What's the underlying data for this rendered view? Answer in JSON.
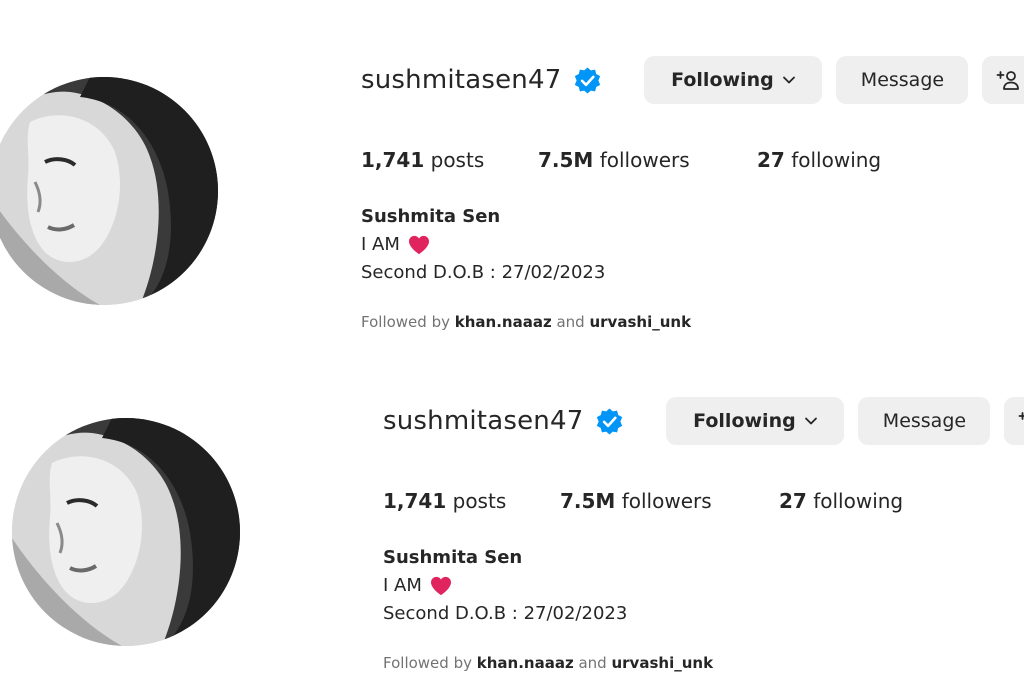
{
  "profiles": [
    {
      "username": "sushmitasen47",
      "following_label": "Following",
      "message_label": "Message",
      "stats": {
        "posts_count": "1,741",
        "posts_label": "posts",
        "followers_count": "7.5M",
        "followers_label": "followers",
        "following_count": "27",
        "following_label": "following"
      },
      "full_name": "Sushmita Sen",
      "bio_line1": "I AM",
      "bio_line2": "Second D.O.B : 27/02/2023",
      "followed_by": {
        "prefix": "Followed by",
        "user1": "khan.naaaz",
        "conj": "and",
        "user2": "urvashi_unk"
      }
    },
    {
      "username": "sushmitasen47",
      "following_label": "Following",
      "message_label": "Message",
      "stats": {
        "posts_count": "1,741",
        "posts_label": "posts",
        "followers_count": "7.5M",
        "followers_label": "followers",
        "following_count": "27",
        "following_label": "following"
      },
      "full_name": "Sushmita Sen",
      "bio_line1": "I AM",
      "bio_line2": "Second D.O.B : 27/02/2023",
      "followed_by": {
        "prefix": "Followed by",
        "user1": "khan.naaaz",
        "conj": "and",
        "user2": "urvashi_unk"
      }
    }
  ],
  "icons": {
    "verified": "verified-badge-icon",
    "chevron": "chevron-down-icon",
    "add_person": "add-person-icon",
    "heart": "red-heart-emoji"
  },
  "colors": {
    "verified_blue": "#0095f6",
    "button_bg": "#efefef",
    "heart_red": "#e0245e",
    "secondary_text": "#737373"
  }
}
